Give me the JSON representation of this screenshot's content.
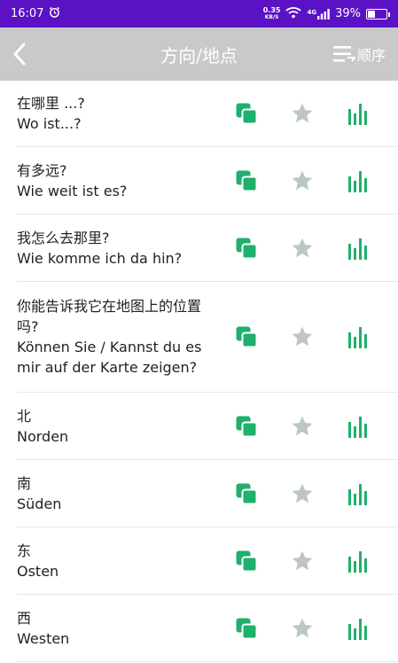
{
  "status": {
    "time": "16:07",
    "speed_top": "0.35",
    "speed_bottom": "KB/S",
    "network": "4G",
    "battery": "39%",
    "battery_level": 0.39
  },
  "header": {
    "title": "方向/地点",
    "sort_label": "顺序"
  },
  "colors": {
    "status_bar": "#5b12c4",
    "app_bar": "#c9c9c9",
    "accent_green": "#1fb06b",
    "star_gray": "#bcc7c3"
  },
  "phrases": [
    {
      "zh": "在哪里 ...?",
      "de": "Wo ist...?"
    },
    {
      "zh": "有多远?",
      "de": "Wie weit ist es?"
    },
    {
      "zh": "我怎么去那里?",
      "de": "Wie komme ich da hin?"
    },
    {
      "zh": "你能告诉我它在地图上的位置吗?",
      "de": "Können Sie / Kannst du es mir auf der Karte zeigen?"
    },
    {
      "zh": "北",
      "de": "Norden"
    },
    {
      "zh": "南",
      "de": "Süden"
    },
    {
      "zh": "东",
      "de": "Osten"
    },
    {
      "zh": "西",
      "de": "Westen"
    }
  ]
}
